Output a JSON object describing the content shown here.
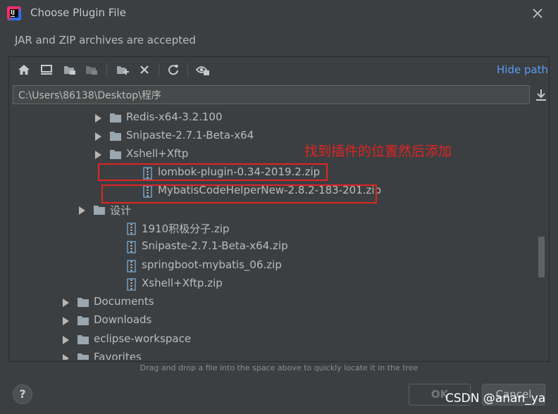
{
  "window": {
    "title": "Choose Plugin File",
    "subtitle": "JAR and ZIP archives are accepted"
  },
  "toolbar": {
    "buttons": [
      "home-icon",
      "desktop-icon",
      "project-folder-icon",
      "module-folder-icon",
      "new-folder-icon",
      "delete-icon",
      "refresh-icon",
      "show-hidden-icon"
    ],
    "hide_path_label": "Hide path"
  },
  "path": {
    "value": "C:\\Users\\86138\\Desktop\\程序"
  },
  "tree": {
    "rows": [
      {
        "label": "Redis-x64-3.2.100",
        "type": "folder",
        "expandable": true
      },
      {
        "label": "Snipaste-2.7.1-Beta-x64",
        "type": "folder",
        "expandable": true
      },
      {
        "label": "Xshell+Xftp",
        "type": "folder",
        "expandable": true
      },
      {
        "label": "lombok-plugin-0.34-2019.2.zip",
        "type": "zip",
        "expandable": false
      },
      {
        "label": "MybatisCodeHelperNew-2.8.2-183-201.zip",
        "type": "zip",
        "expandable": false
      },
      {
        "label": "设计",
        "type": "folder",
        "expandable": true
      },
      {
        "label": "1910积极分子.zip",
        "type": "zip",
        "expandable": false
      },
      {
        "label": "Snipaste-2.7.1-Beta-x64.zip",
        "type": "zip",
        "expandable": false
      },
      {
        "label": "springboot-mybatis_06.zip",
        "type": "zip",
        "expandable": false
      },
      {
        "label": "Xshell+Xftp.zip",
        "type": "zip",
        "expandable": false
      },
      {
        "label": "Documents",
        "type": "folder",
        "expandable": true
      },
      {
        "label": "Downloads",
        "type": "folder",
        "expandable": true
      },
      {
        "label": "eclipse-workspace",
        "type": "folder",
        "expandable": true
      },
      {
        "label": "Favorites",
        "type": "folder",
        "expandable": true
      }
    ]
  },
  "annotation": {
    "text": "找到插件的位置然后添加",
    "color": "#e02424"
  },
  "hint": "Drag and drop a file into the space above to quickly locate it in the tree",
  "footer": {
    "help_label": "?",
    "ok_label": "OK",
    "cancel_label": "Cancel"
  },
  "watermark": "CSDN @anan_ya",
  "colors": {
    "background": "#3c3f41",
    "link": "#589df6",
    "folder": "#9aa7b0",
    "zip_icon": "#6f9ec8"
  }
}
